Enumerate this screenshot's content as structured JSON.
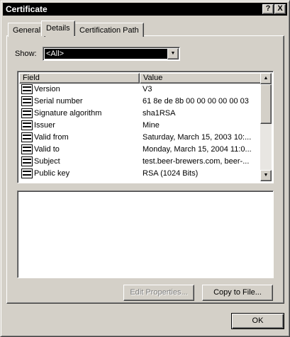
{
  "window": {
    "title": "Certificate",
    "help_glyph": "?",
    "close_glyph": "X"
  },
  "tabs": [
    {
      "label": "General"
    },
    {
      "label": "Details"
    },
    {
      "label": "Certification Path"
    }
  ],
  "show": {
    "label": "Show:",
    "selected": "<All>"
  },
  "fields_list": {
    "columns": [
      "Field",
      "Value"
    ],
    "rows": [
      {
        "field": "Version",
        "value": "V3"
      },
      {
        "field": "Serial number",
        "value": "61 8e de 8b 00 00 00 00 00 03"
      },
      {
        "field": "Signature algorithm",
        "value": "sha1RSA"
      },
      {
        "field": "Issuer",
        "value": "Mine"
      },
      {
        "field": "Valid from",
        "value": "Saturday, March 15, 2003 10:..."
      },
      {
        "field": "Valid to",
        "value": "Monday, March 15, 2004 11:0..."
      },
      {
        "field": "Subject",
        "value": "test.beer-brewers.com, beer-..."
      },
      {
        "field": "Public key",
        "value": "RSA (1024 Bits)"
      }
    ]
  },
  "buttons": {
    "edit_properties": "Edit Properties...",
    "copy_to_file": "Copy to File...",
    "ok": "OK"
  }
}
